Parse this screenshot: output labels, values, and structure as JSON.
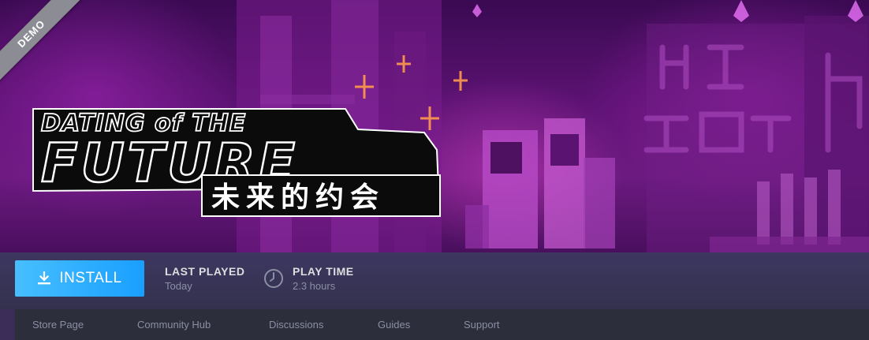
{
  "game": {
    "title_line1": "DATING of THE",
    "title_line2": "FUTURE",
    "subtitle_glyphs": "未来的约会"
  },
  "badge": {
    "label": "DEMO"
  },
  "actions": {
    "install_label": "INSTALL",
    "install_icon": "download-icon"
  },
  "stats": {
    "last_played_label": "LAST PLAYED",
    "last_played_value": "Today",
    "play_time_label": "PLAY TIME",
    "play_time_value": "2.3 hours",
    "play_time_icon": "clock-icon"
  },
  "subnav": {
    "items": [
      "Store Page",
      "Community Hub",
      "Discussions",
      "Guides",
      "Support"
    ]
  },
  "colors": {
    "install_button": "#1a9fff",
    "hero_accent": "#a12bbd",
    "badge": "#8c8c94"
  }
}
